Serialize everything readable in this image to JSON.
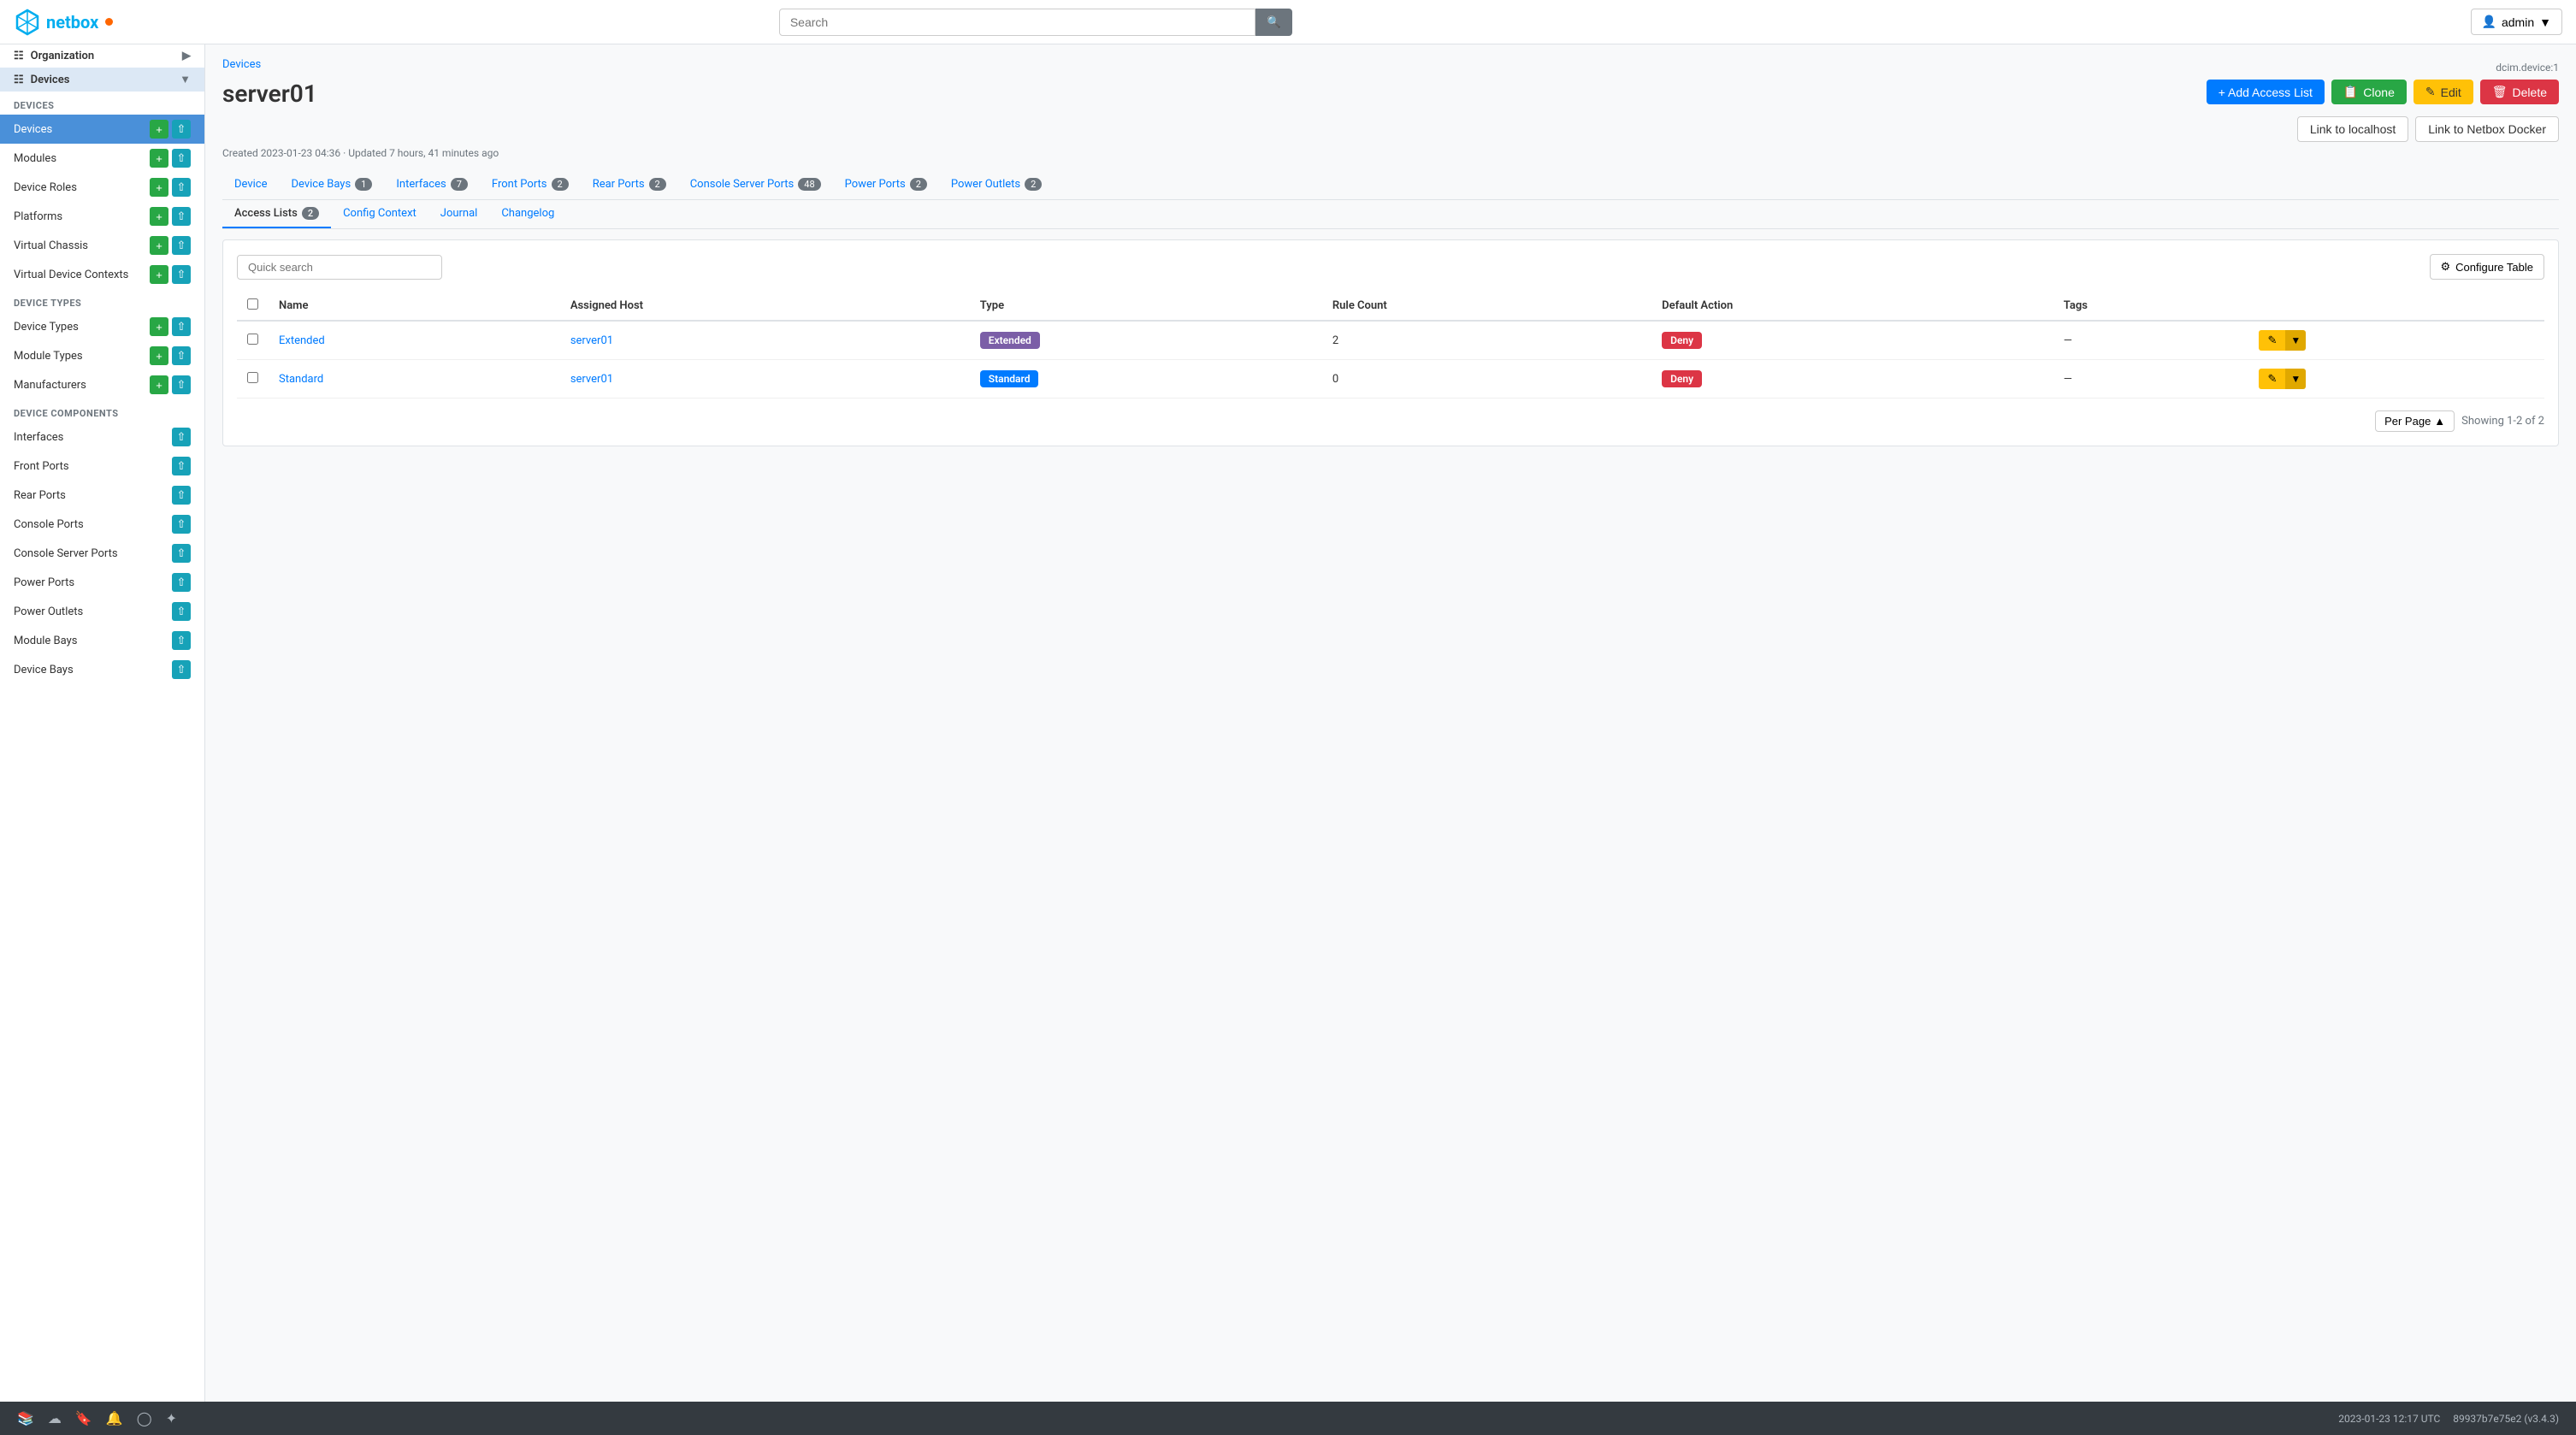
{
  "app": {
    "name": "netbox",
    "logo_icon": "⬡"
  },
  "topnav": {
    "search_placeholder": "Search",
    "user_label": "admin",
    "user_icon": "👤"
  },
  "sidebar": {
    "section_devices": "DEVICES",
    "section_device_types": "DEVICE TYPES",
    "section_device_components": "DEVICE COMPONENTS",
    "items_devices": [
      {
        "label": "Devices",
        "active": true
      },
      {
        "label": "Modules",
        "active": false
      },
      {
        "label": "Device Roles",
        "active": false
      },
      {
        "label": "Platforms",
        "active": false
      },
      {
        "label": "Virtual Chassis",
        "active": false
      },
      {
        "label": "Virtual Device Contexts",
        "active": false
      }
    ],
    "items_device_types": [
      {
        "label": "Device Types",
        "active": false
      },
      {
        "label": "Module Types",
        "active": false
      },
      {
        "label": "Manufacturers",
        "active": false
      }
    ],
    "items_device_components": [
      {
        "label": "Interfaces",
        "active": false
      },
      {
        "label": "Front Ports",
        "active": false
      },
      {
        "label": "Rear Ports",
        "active": false
      },
      {
        "label": "Console Ports",
        "active": false
      },
      {
        "label": "Console Server Ports",
        "active": false
      },
      {
        "label": "Power Ports",
        "active": false
      },
      {
        "label": "Power Outlets",
        "active": false
      },
      {
        "label": "Module Bays",
        "active": false
      },
      {
        "label": "Device Bays",
        "active": false
      }
    ],
    "nav_groups": [
      {
        "label": "Organization",
        "has_arrow": true
      },
      {
        "label": "Devices",
        "has_arrow": true,
        "active": true
      }
    ]
  },
  "breadcrumb": "Devices",
  "page": {
    "title": "server01",
    "meta": "Created 2023-01-23 04:36 · Updated 7 hours, 41 minutes ago",
    "dcim_ref": "dcim.device:1"
  },
  "actions": {
    "add_access_list": "+ Add Access List",
    "clone": "Clone",
    "edit": "Edit",
    "delete": "Delete",
    "link_localhost": "Link to localhost",
    "link_netbox_docker": "Link to Netbox Docker"
  },
  "tabs": [
    {
      "label": "Device",
      "badge": null,
      "active": false
    },
    {
      "label": "Device Bays",
      "badge": "1",
      "active": false
    },
    {
      "label": "Interfaces",
      "badge": "7",
      "active": false
    },
    {
      "label": "Front Ports",
      "badge": "2",
      "active": false
    },
    {
      "label": "Rear Ports",
      "badge": "2",
      "active": false
    },
    {
      "label": "Console Server Ports",
      "badge": "48",
      "active": false
    },
    {
      "label": "Power Ports",
      "badge": "2",
      "active": false
    },
    {
      "label": "Power Outlets",
      "badge": "2",
      "active": false
    }
  ],
  "subtabs": [
    {
      "label": "Access Lists",
      "badge": "2",
      "active": true
    },
    {
      "label": "Config Context",
      "badge": null,
      "active": false
    },
    {
      "label": "Journal",
      "badge": null,
      "active": false
    },
    {
      "label": "Changelog",
      "badge": null,
      "active": false
    }
  ],
  "toolbar": {
    "search_placeholder": "Quick search",
    "configure_table": "Configure Table",
    "gear_icon": "⚙"
  },
  "table": {
    "columns": [
      "Name",
      "Assigned Host",
      "Type",
      "Rule Count",
      "Default Action",
      "Tags"
    ],
    "rows": [
      {
        "name": "Extended",
        "assigned_host": "server01",
        "type": "Extended",
        "type_color": "purple",
        "rule_count": "2",
        "default_action": "Deny",
        "tags": "—"
      },
      {
        "name": "Standard",
        "assigned_host": "server01",
        "type": "Standard",
        "type_color": "blue",
        "rule_count": "0",
        "default_action": "Deny",
        "tags": "—"
      }
    ]
  },
  "pagination": {
    "per_page_label": "Per Page",
    "showing": "Showing 1-2 of 2"
  },
  "footer": {
    "timestamp": "2023-01-23 12:17 UTC",
    "version": "89937b7e75e2 (v3.4.3)"
  }
}
